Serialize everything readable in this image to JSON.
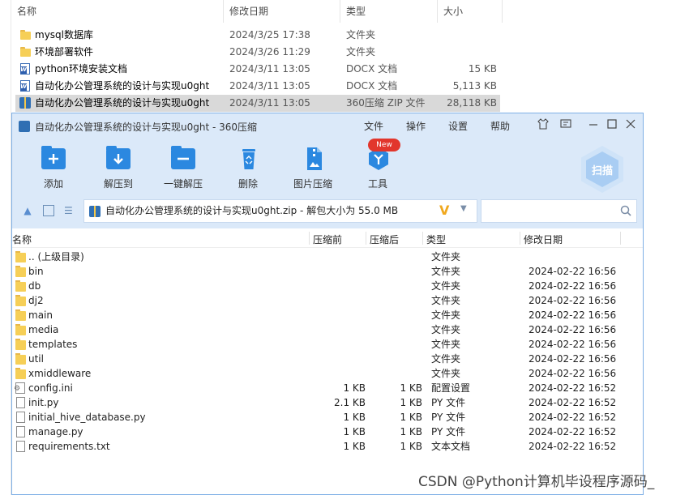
{
  "explorer": {
    "headers": {
      "name": "名称",
      "date": "修改日期",
      "type": "类型",
      "size": "大小"
    },
    "rows": [
      {
        "name": "mysql数据库",
        "date": "2024/3/25 17:38",
        "type": "文件夹",
        "size": "",
        "icon": "folder-icon"
      },
      {
        "name": "环境部署软件",
        "date": "2024/3/26 11:29",
        "type": "文件夹",
        "size": "",
        "icon": "folder-icon"
      },
      {
        "name": "python环境安装文档",
        "date": "2024/3/11 13:05",
        "type": "DOCX 文档",
        "size": "15 KB",
        "icon": "docx-icon"
      },
      {
        "name": "自动化办公管理系统的设计与实现u0ght",
        "date": "2024/3/11 13:05",
        "type": "DOCX 文档",
        "size": "5,113 KB",
        "icon": "docx-icon"
      },
      {
        "name": "自动化办公管理系统的设计与实现u0ght",
        "date": "2024/3/11 13:05",
        "type": "360压缩 ZIP 文件",
        "size": "28,118 KB",
        "icon": "zip-icon",
        "selected": true
      }
    ]
  },
  "window": {
    "title": "自动化办公管理系统的设计与实现u0ght - 360压缩",
    "menu": {
      "file": "文件",
      "action": "操作",
      "settings": "设置",
      "help": "帮助"
    },
    "toolbar": {
      "add": "添加",
      "extract_to": "解压到",
      "one_click_extract": "一键解压",
      "delete": "删除",
      "image_compress": "图片压缩",
      "tools": "工具",
      "new_badge": "New",
      "scan": "扫描"
    },
    "address": {
      "path": "自动化办公管理系统的设计与实现u0ght.zip - 解包大小为 55.0 MB",
      "search_placeholder": ""
    },
    "list_headers": {
      "name": "名称",
      "compressed": "压缩前",
      "original": "压缩后",
      "type": "类型",
      "date": "修改日期"
    },
    "files": [
      {
        "name": ".. (上级目录)",
        "csize": "",
        "osize": "",
        "type": "文件夹",
        "date": "",
        "icon": "folder"
      },
      {
        "name": "bin",
        "csize": "",
        "osize": "",
        "type": "文件夹",
        "date": "2024-02-22 16:56",
        "icon": "folder"
      },
      {
        "name": "db",
        "csize": "",
        "osize": "",
        "type": "文件夹",
        "date": "2024-02-22 16:56",
        "icon": "folder"
      },
      {
        "name": "dj2",
        "csize": "",
        "osize": "",
        "type": "文件夹",
        "date": "2024-02-22 16:56",
        "icon": "folder"
      },
      {
        "name": "main",
        "csize": "",
        "osize": "",
        "type": "文件夹",
        "date": "2024-02-22 16:56",
        "icon": "folder"
      },
      {
        "name": "media",
        "csize": "",
        "osize": "",
        "type": "文件夹",
        "date": "2024-02-22 16:56",
        "icon": "folder"
      },
      {
        "name": "templates",
        "csize": "",
        "osize": "",
        "type": "文件夹",
        "date": "2024-02-22 16:56",
        "icon": "folder"
      },
      {
        "name": "util",
        "csize": "",
        "osize": "",
        "type": "文件夹",
        "date": "2024-02-22 16:56",
        "icon": "folder"
      },
      {
        "name": "xmiddleware",
        "csize": "",
        "osize": "",
        "type": "文件夹",
        "date": "2024-02-22 16:56",
        "icon": "folder"
      },
      {
        "name": "config.ini",
        "csize": "1 KB",
        "osize": "1 KB",
        "type": "配置设置",
        "date": "2024-02-22 16:52",
        "icon": "config"
      },
      {
        "name": "init.py",
        "csize": "2.1 KB",
        "osize": "1 KB",
        "type": "PY 文件",
        "date": "2024-02-22 16:52",
        "icon": "file"
      },
      {
        "name": "initial_hive_database.py",
        "csize": "1 KB",
        "osize": "1 KB",
        "type": "PY 文件",
        "date": "2024-02-22 16:52",
        "icon": "file"
      },
      {
        "name": "manage.py",
        "csize": "1 KB",
        "osize": "1 KB",
        "type": "PY 文件",
        "date": "2024-02-22 16:52",
        "icon": "file"
      },
      {
        "name": "requirements.txt",
        "csize": "1 KB",
        "osize": "1 KB",
        "type": "文本文档",
        "date": "2024-02-22 16:52",
        "icon": "file"
      }
    ]
  },
  "watermark": "CSDN @Python计算机毕设程序源码_"
}
